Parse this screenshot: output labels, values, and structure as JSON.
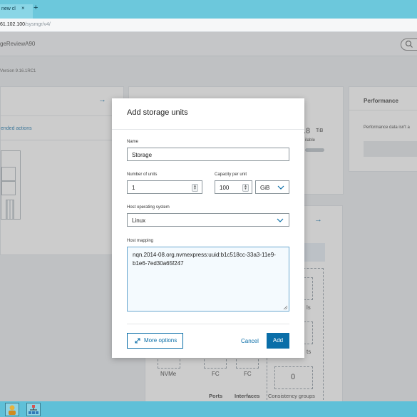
{
  "browser": {
    "tab_title": "new cl",
    "tab_close": "×",
    "new_tab": "+",
    "url_host": "61.102.100",
    "url_path": "/sysmgr/v4/"
  },
  "app": {
    "name": "geReviewA90",
    "version": "Version 9.16.1RC1"
  },
  "background": {
    "left_card_arrow": "→",
    "left_card_link": "ended actions",
    "capacity_value": ".8",
    "capacity_unit": "TiB",
    "capacity_sub": "ilable",
    "performance_title": "Performance",
    "performance_text": "Performance data isn't a",
    "mid_arrow": "→",
    "nvme_label": "NVMe",
    "fc_label_1": "FC",
    "fc_label_2": "FC",
    "ports_label": "Ports",
    "interfaces_label": "Interfaces",
    "consistency_count": "0",
    "consistency_label": "Consistency groups",
    "ls_fragment": "ls",
    "ts_fragment": "ts"
  },
  "modal": {
    "title": "Add storage units",
    "name_label": "Name",
    "name_value": "Storage",
    "units_label": "Number of units",
    "units_value": "1",
    "capacity_label": "Capacity per unit",
    "capacity_value": "100",
    "capacity_unit": "GiB",
    "os_label": "Host operating system",
    "os_value": "Linux",
    "mapping_label": "Host mapping",
    "mapping_line1": "nqn.2014-08.org.nvmexpress:uuid:b1c518cc-33a3-11e9-",
    "mapping_line2": "b1e6-7ed30a65f247",
    "more_options": "More options",
    "cancel": "Cancel",
    "add": "Add"
  }
}
